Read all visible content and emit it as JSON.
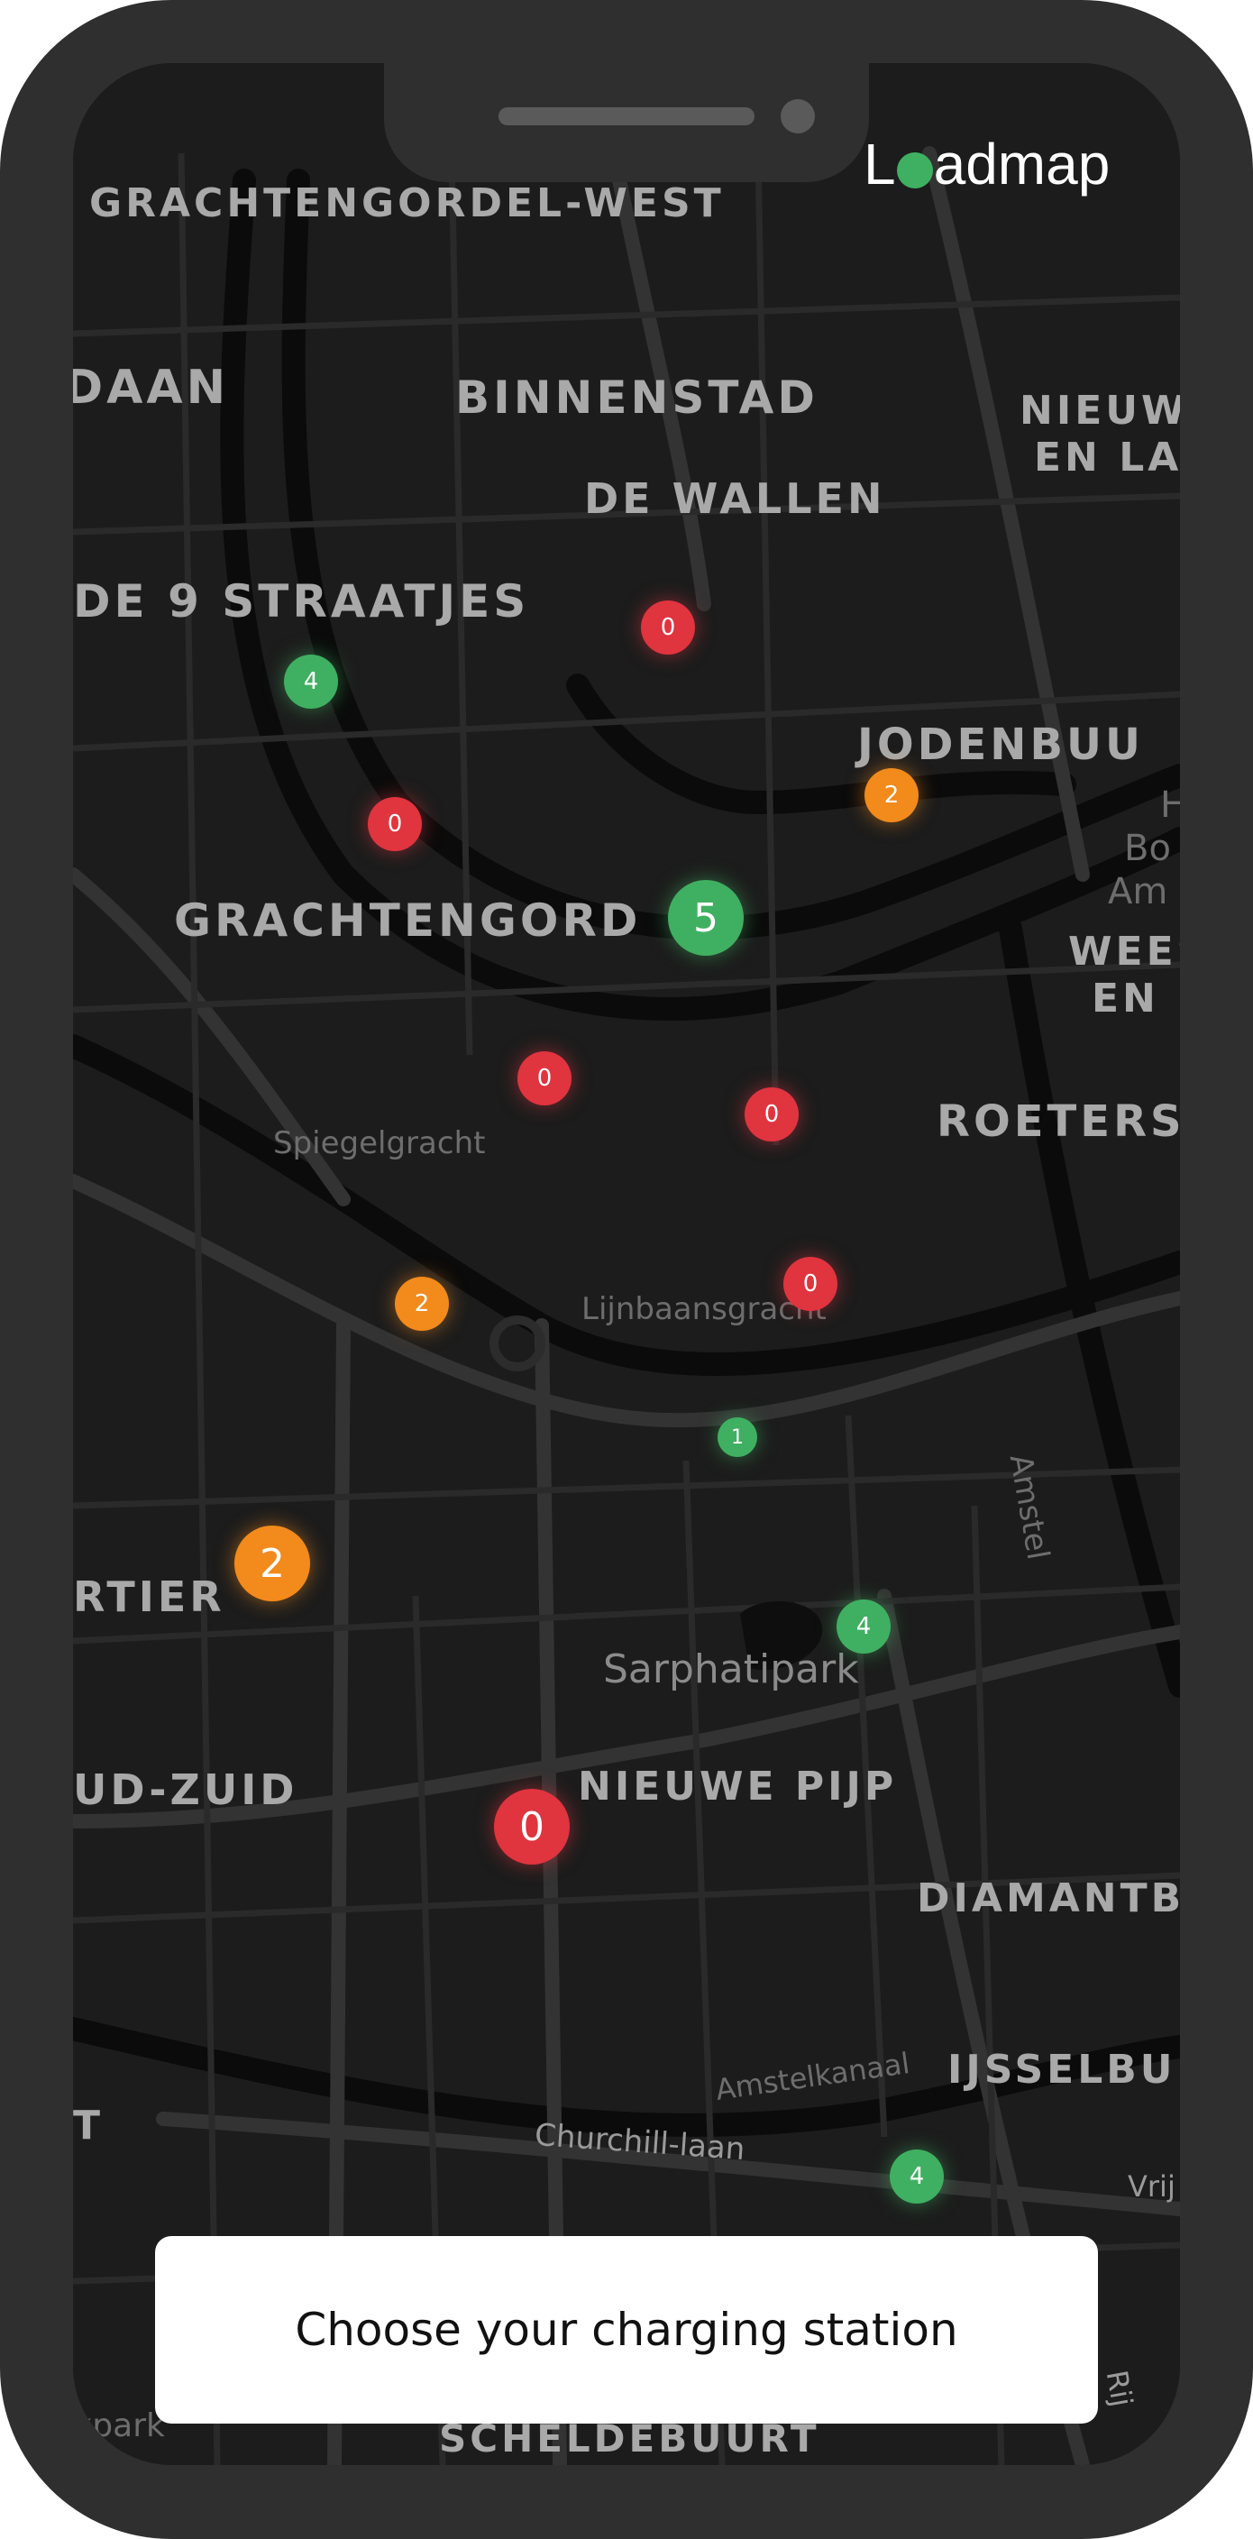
{
  "app": {
    "logo_left": "L",
    "logo_right": "admap"
  },
  "colors": {
    "available": "#3fb061",
    "occupied": "#e0343f",
    "limited": "#f28a1c",
    "map_background": "#1c1c1c"
  },
  "map": {
    "area_labels": [
      "GRACHTENGORDEL-WEST",
      "DAAN",
      "BINNENSTAD",
      "DE WALLEN",
      "NIEUW",
      "EN LA",
      "DE 9 STRAATJES",
      "JODENBUU",
      "GRACHTENGORD",
      "WEES",
      "EN I",
      "ROETERS",
      "RTIER",
      "UD-ZUID",
      "NIEUWE PIJP",
      "DIAMANTB",
      "IJSSELBU",
      "T",
      "SCHELDEBUURT"
    ],
    "street_labels": [
      "Spiegelgracht",
      "Lijnbaansgracht",
      "Amstel",
      "Amstelkanaal",
      "Churchill-laan",
      "Vrij",
      "Rij",
      "H",
      "Bo",
      "Am",
      "xpark"
    ],
    "park_label": "Sarphatipark",
    "stations": [
      {
        "count": "0",
        "status": "occupied"
      },
      {
        "count": "4",
        "status": "available"
      },
      {
        "count": "2",
        "status": "limited"
      },
      {
        "count": "0",
        "status": "occupied"
      },
      {
        "count": "5",
        "status": "available"
      },
      {
        "count": "0",
        "status": "occupied"
      },
      {
        "count": "0",
        "status": "occupied"
      },
      {
        "count": "2",
        "status": "limited"
      },
      {
        "count": "0",
        "status": "occupied"
      },
      {
        "count": "1",
        "status": "available"
      },
      {
        "count": "2",
        "status": "limited"
      },
      {
        "count": "4",
        "status": "available"
      },
      {
        "count": "0",
        "status": "occupied"
      },
      {
        "count": "4",
        "status": "available"
      }
    ]
  },
  "cta": {
    "label": "Choose your charging station"
  }
}
